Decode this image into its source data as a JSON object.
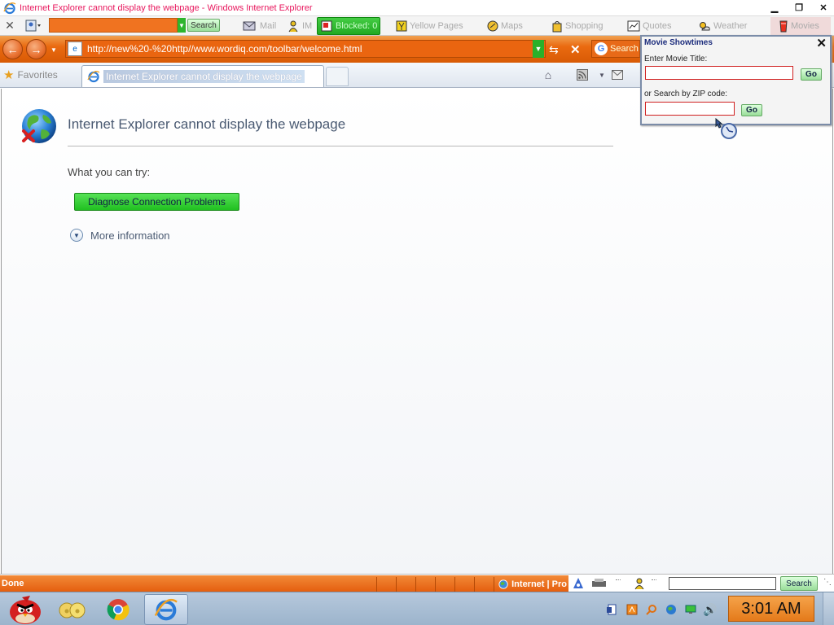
{
  "window": {
    "title": "Internet Explorer cannot display the webpage - Windows Internet Explorer"
  },
  "search_toolbar": {
    "close_glyph": "✕",
    "search_button": "Search",
    "items": {
      "mail": "Mail",
      "im": "IM",
      "blocked": "Blocked: 0",
      "yellow_pages": "Yellow Pages",
      "maps": "Maps",
      "shopping": "Shopping",
      "quotes": "Quotes",
      "weather": "Weather",
      "movies": "Movies"
    }
  },
  "address_bar": {
    "url": "http://new%20-%20http//www.wordiq.com/toolbar/welcome.html",
    "search_provider_text": "Search"
  },
  "tabs_bar": {
    "favorites_label": "Favorites",
    "active_tab_title": "Internet Explorer cannot display the webpage"
  },
  "error_page": {
    "heading": "Internet Explorer cannot display the webpage",
    "try_label": "What you can try:",
    "diagnose_button": "Diagnose Connection Problems",
    "more_info_link": "More information"
  },
  "movie_popup": {
    "title": "Movie Showtimes",
    "movie_title_label": "Enter Movie Title:",
    "movie_title_value": "",
    "zip_label": "or Search by ZIP code:",
    "zip_value": "",
    "go_label": "Go"
  },
  "status_bar": {
    "status_text": "Done",
    "zone_text": "Internet | Pro",
    "search_button": "Search",
    "search_value": ""
  },
  "taskbar": {
    "clock": "3:01 AM"
  },
  "colors": {
    "toolbar_orange": "#ea6510",
    "title_pink": "#e8175d",
    "go_green": "#2ab02a",
    "clock_orange": "#f0902e"
  }
}
